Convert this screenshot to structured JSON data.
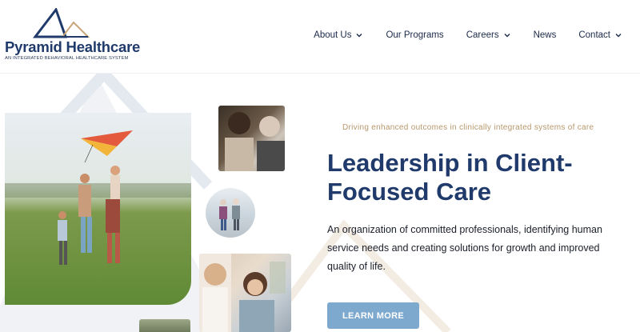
{
  "brand": {
    "name": "Pyramid Healthcare",
    "tagline": "AN INTEGRATED BEHAVIORAL HEALTHCARE SYSTEM",
    "primary_color": "#1f3a6b",
    "accent_color": "#c9a57a"
  },
  "nav": {
    "items": [
      {
        "label": "About Us",
        "has_dropdown": true,
        "icon": "chevron-down-icon"
      },
      {
        "label": "Our Programs",
        "has_dropdown": false
      },
      {
        "label": "Careers",
        "has_dropdown": true,
        "icon": "chevron-down-icon"
      },
      {
        "label": "News",
        "has_dropdown": false
      },
      {
        "label": "Contact",
        "has_dropdown": true,
        "icon": "chevron-down-icon"
      }
    ]
  },
  "hero": {
    "tagline": "Driving enhanced outcomes in clinically integrated systems of care",
    "headline": "Leadership in Client-Focused Care",
    "body": "An organization of committed professionals, identifying human service needs and creating solutions for growth and improved quality of life.",
    "cta_label": "LEARN MORE",
    "cta_color": "#7ea9cf",
    "tagline_color": "#b8976b"
  }
}
